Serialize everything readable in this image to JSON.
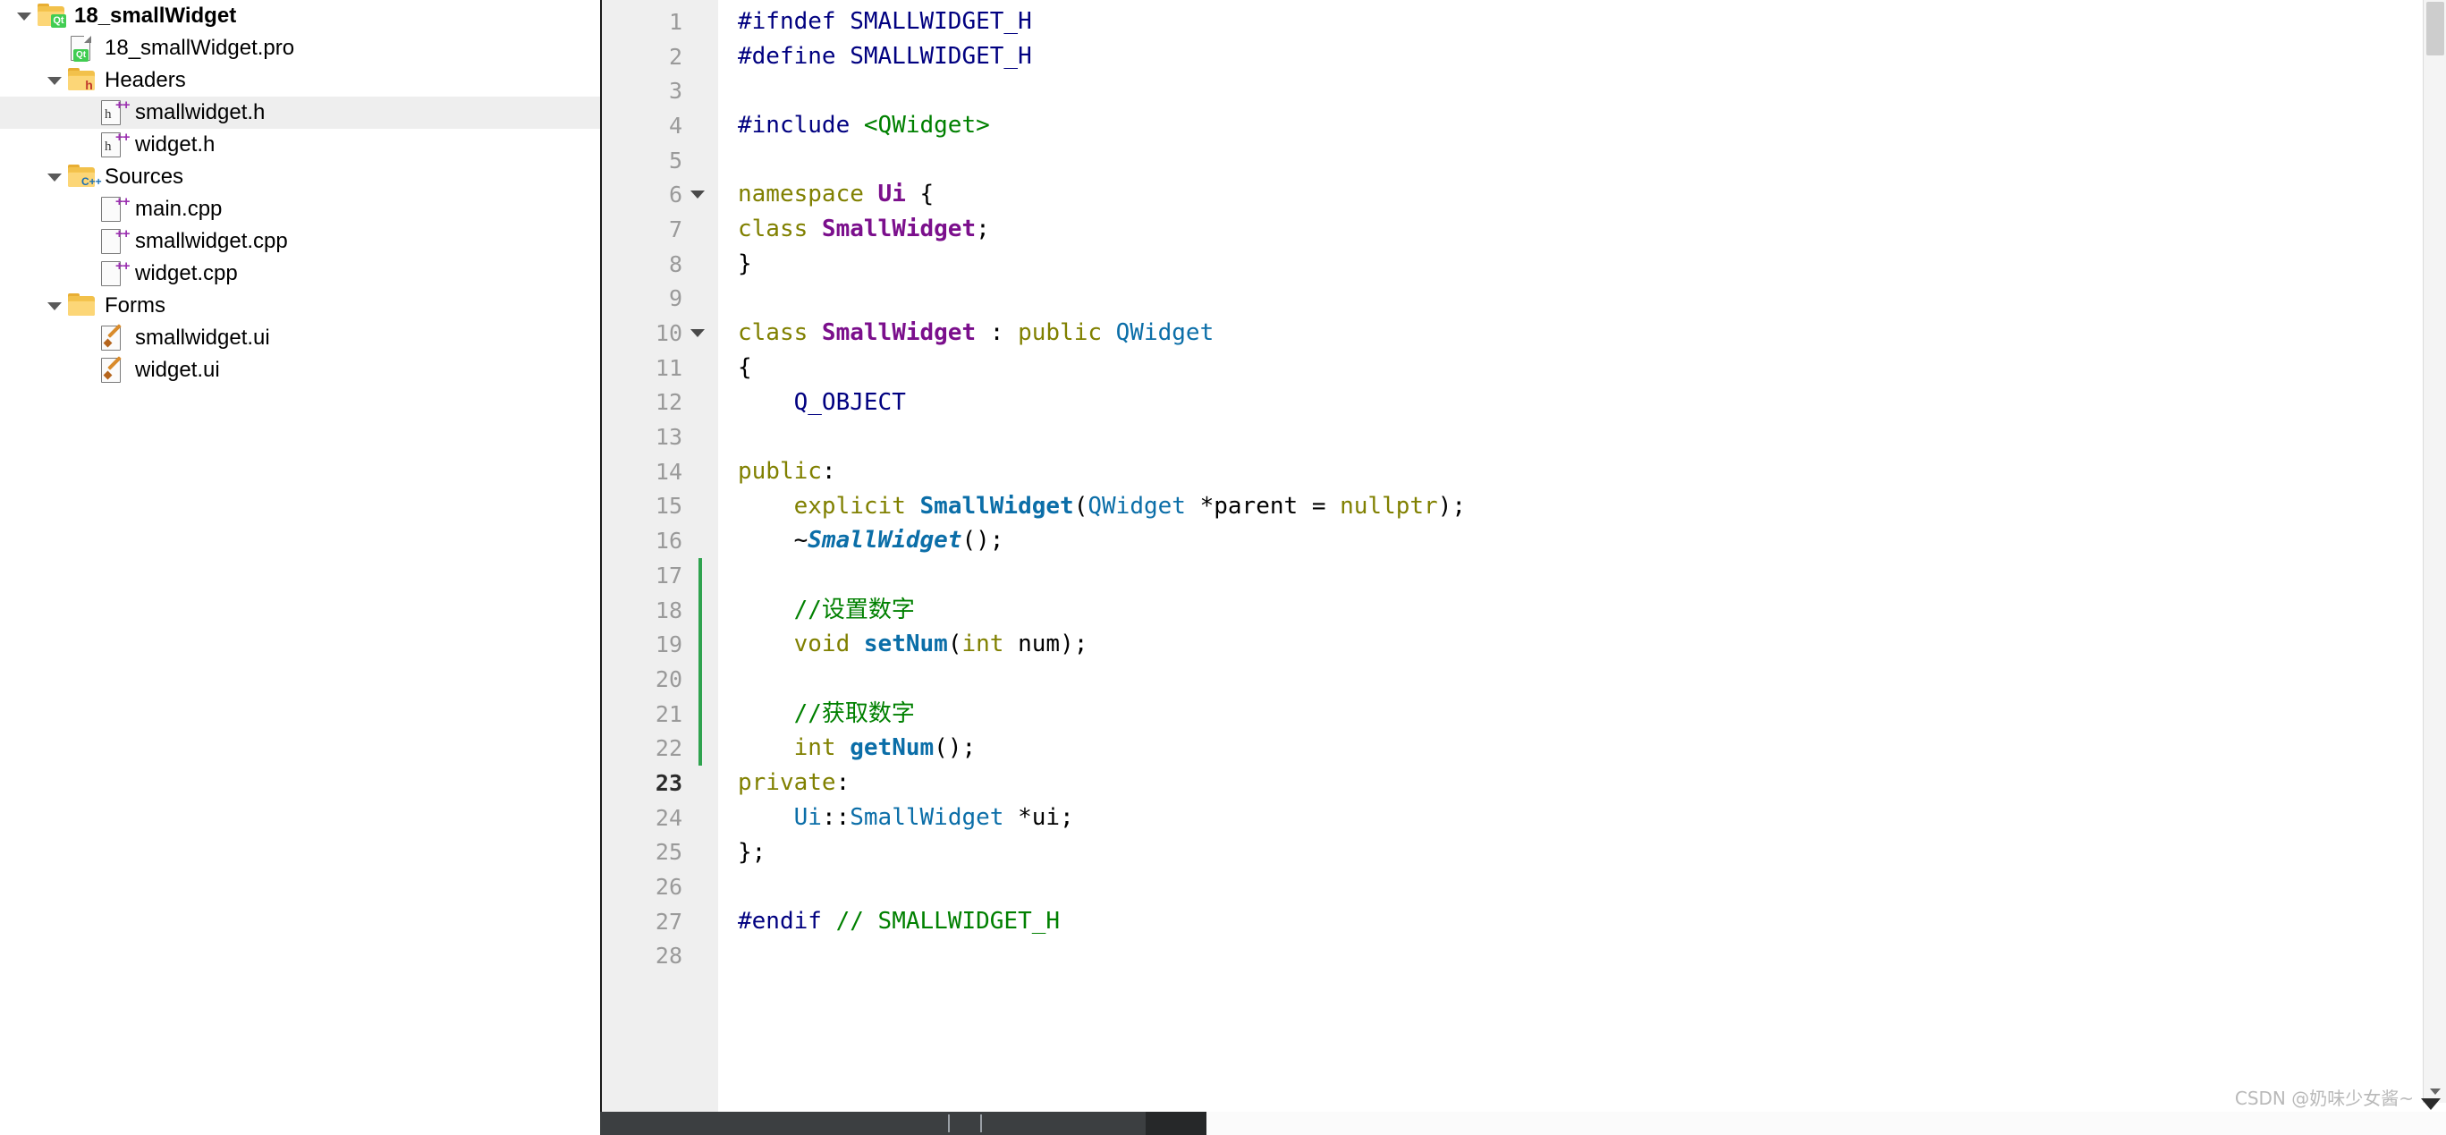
{
  "sidebar": {
    "items": [
      {
        "label": "18_smallWidget",
        "icon": "folder-qt-icon",
        "indent": 0,
        "expanded": true,
        "bold": true,
        "selected": false
      },
      {
        "label": "18_smallWidget.pro",
        "icon": "file-qt-pro-icon",
        "indent": 1,
        "expanded": null,
        "bold": false,
        "selected": false
      },
      {
        "label": "Headers",
        "icon": "folder-headers-icon",
        "indent": 1,
        "expanded": true,
        "bold": false,
        "selected": false
      },
      {
        "label": "smallwidget.h",
        "icon": "file-header-icon",
        "indent": 2,
        "expanded": null,
        "bold": false,
        "selected": true
      },
      {
        "label": "widget.h",
        "icon": "file-header-icon",
        "indent": 2,
        "expanded": null,
        "bold": false,
        "selected": false
      },
      {
        "label": "Sources",
        "icon": "folder-sources-icon",
        "indent": 1,
        "expanded": true,
        "bold": false,
        "selected": false
      },
      {
        "label": "main.cpp",
        "icon": "file-cpp-icon",
        "indent": 2,
        "expanded": null,
        "bold": false,
        "selected": false
      },
      {
        "label": "smallwidget.cpp",
        "icon": "file-cpp-icon",
        "indent": 2,
        "expanded": null,
        "bold": false,
        "selected": false
      },
      {
        "label": "widget.cpp",
        "icon": "file-cpp-icon",
        "indent": 2,
        "expanded": null,
        "bold": false,
        "selected": false
      },
      {
        "label": "Forms",
        "icon": "folder-forms-icon",
        "indent": 1,
        "expanded": true,
        "bold": false,
        "selected": false
      },
      {
        "label": "smallwidget.ui",
        "icon": "file-ui-icon",
        "indent": 2,
        "expanded": null,
        "bold": false,
        "selected": false
      },
      {
        "label": "widget.ui",
        "icon": "file-ui-icon",
        "indent": 2,
        "expanded": null,
        "bold": false,
        "selected": false
      }
    ]
  },
  "editor": {
    "current_line": 23,
    "lines": [
      {
        "n": 1,
        "fold": false,
        "changed": false,
        "tokens": [
          {
            "t": "#ifndef SMALLWIDGET_H",
            "c": "k-pre"
          }
        ]
      },
      {
        "n": 2,
        "fold": false,
        "changed": false,
        "tokens": [
          {
            "t": "#define SMALLWIDGET_H",
            "c": "k-pre"
          }
        ]
      },
      {
        "n": 3,
        "fold": false,
        "changed": false,
        "tokens": []
      },
      {
        "n": 4,
        "fold": false,
        "changed": false,
        "tokens": [
          {
            "t": "#include ",
            "c": "k-pre"
          },
          {
            "t": "<QWidget>",
            "c": "k-inc"
          }
        ]
      },
      {
        "n": 5,
        "fold": false,
        "changed": false,
        "tokens": []
      },
      {
        "n": 6,
        "fold": true,
        "changed": false,
        "tokens": [
          {
            "t": "namespace ",
            "c": "k-kw"
          },
          {
            "t": "Ui",
            "c": "k-type"
          },
          {
            "t": " {",
            "c": "k-plain"
          }
        ]
      },
      {
        "n": 7,
        "fold": false,
        "changed": false,
        "tokens": [
          {
            "t": "class ",
            "c": "k-kw"
          },
          {
            "t": "SmallWidget",
            "c": "k-type"
          },
          {
            "t": ";",
            "c": "k-plain"
          }
        ]
      },
      {
        "n": 8,
        "fold": false,
        "changed": false,
        "tokens": [
          {
            "t": "}",
            "c": "k-plain"
          }
        ]
      },
      {
        "n": 9,
        "fold": false,
        "changed": false,
        "tokens": []
      },
      {
        "n": 10,
        "fold": true,
        "changed": false,
        "tokens": [
          {
            "t": "class ",
            "c": "k-kw"
          },
          {
            "t": "SmallWidget",
            "c": "k-type"
          },
          {
            "t": " : ",
            "c": "k-plain"
          },
          {
            "t": "public",
            "c": "k-kw"
          },
          {
            "t": " ",
            "c": "k-plain"
          },
          {
            "t": "QWidget",
            "c": "k-cls"
          }
        ]
      },
      {
        "n": 11,
        "fold": false,
        "changed": false,
        "tokens": [
          {
            "t": "{",
            "c": "k-plain"
          }
        ]
      },
      {
        "n": 12,
        "fold": false,
        "changed": false,
        "tokens": [
          {
            "t": "    ",
            "c": "k-plain"
          },
          {
            "t": "Q_OBJECT",
            "c": "k-id"
          }
        ]
      },
      {
        "n": 13,
        "fold": false,
        "changed": false,
        "tokens": []
      },
      {
        "n": 14,
        "fold": false,
        "changed": false,
        "tokens": [
          {
            "t": "public",
            "c": "k-kw"
          },
          {
            "t": ":",
            "c": "k-plain"
          }
        ]
      },
      {
        "n": 15,
        "fold": false,
        "changed": false,
        "tokens": [
          {
            "t": "    ",
            "c": "k-plain"
          },
          {
            "t": "explicit ",
            "c": "k-kw"
          },
          {
            "t": "SmallWidget",
            "c": "k-typeb"
          },
          {
            "t": "(",
            "c": "k-plain"
          },
          {
            "t": "QWidget",
            "c": "k-cls"
          },
          {
            "t": " *parent = ",
            "c": "k-plain"
          },
          {
            "t": "nullptr",
            "c": "k-kw"
          },
          {
            "t": ");",
            "c": "k-plain"
          }
        ]
      },
      {
        "n": 16,
        "fold": false,
        "changed": false,
        "tokens": [
          {
            "t": "    ~",
            "c": "k-plain"
          },
          {
            "t": "SmallWidget",
            "c": "k-typei"
          },
          {
            "t": "();",
            "c": "k-plain"
          }
        ]
      },
      {
        "n": 17,
        "fold": false,
        "changed": true,
        "tokens": []
      },
      {
        "n": 18,
        "fold": false,
        "changed": true,
        "tokens": [
          {
            "t": "    ",
            "c": "k-plain"
          },
          {
            "t": "//设置数字",
            "c": "k-cmt"
          }
        ]
      },
      {
        "n": 19,
        "fold": false,
        "changed": true,
        "tokens": [
          {
            "t": "    ",
            "c": "k-plain"
          },
          {
            "t": "void ",
            "c": "k-kw"
          },
          {
            "t": "setNum",
            "c": "k-fn"
          },
          {
            "t": "(",
            "c": "k-plain"
          },
          {
            "t": "int",
            "c": "k-kw"
          },
          {
            "t": " num);",
            "c": "k-plain"
          }
        ]
      },
      {
        "n": 20,
        "fold": false,
        "changed": true,
        "tokens": []
      },
      {
        "n": 21,
        "fold": false,
        "changed": true,
        "tokens": [
          {
            "t": "    ",
            "c": "k-plain"
          },
          {
            "t": "//获取数字",
            "c": "k-cmt"
          }
        ]
      },
      {
        "n": 22,
        "fold": false,
        "changed": true,
        "tokens": [
          {
            "t": "    ",
            "c": "k-plain"
          },
          {
            "t": "int ",
            "c": "k-kw"
          },
          {
            "t": "getNum",
            "c": "k-fn"
          },
          {
            "t": "();",
            "c": "k-plain"
          }
        ]
      },
      {
        "n": 23,
        "fold": false,
        "changed": false,
        "tokens": [
          {
            "t": "private",
            "c": "k-kw"
          },
          {
            "t": ":",
            "c": "k-plain"
          }
        ]
      },
      {
        "n": 24,
        "fold": false,
        "changed": false,
        "tokens": [
          {
            "t": "    ",
            "c": "k-plain"
          },
          {
            "t": "Ui",
            "c": "k-cls"
          },
          {
            "t": "::",
            "c": "k-plain"
          },
          {
            "t": "SmallWidget",
            "c": "k-cls"
          },
          {
            "t": " *ui;",
            "c": "k-plain"
          }
        ]
      },
      {
        "n": 25,
        "fold": false,
        "changed": false,
        "tokens": [
          {
            "t": "};",
            "c": "k-plain"
          }
        ]
      },
      {
        "n": 26,
        "fold": false,
        "changed": false,
        "tokens": []
      },
      {
        "n": 27,
        "fold": false,
        "changed": false,
        "tokens": [
          {
            "t": "#endif ",
            "c": "k-pre"
          },
          {
            "t": "// SMALLWIDGET_H",
            "c": "k-cmt"
          }
        ]
      },
      {
        "n": 28,
        "fold": false,
        "changed": false,
        "tokens": []
      }
    ]
  },
  "watermark": {
    "text": "CSDN @奶味少女酱~"
  },
  "colors": {
    "selection": "#eeeeee",
    "gutter_bg": "#efefef",
    "gutter_fg": "#9a9a9a",
    "change_marker": "#2fa34f",
    "preprocessor": "#000080",
    "include": "#008000",
    "keyword": "#808000",
    "class_name": "#7b0f8c",
    "declared_name": "#0b6ea8",
    "comment": "#008000",
    "bottom_bar": "#3c3f41"
  }
}
